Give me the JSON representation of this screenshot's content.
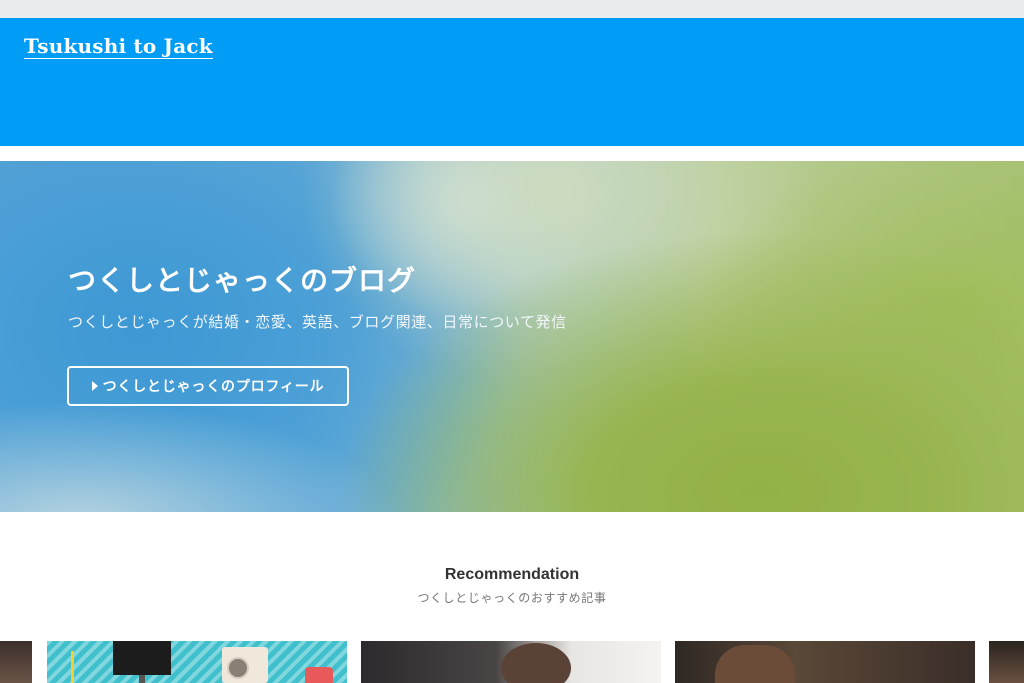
{
  "header": {
    "logo_text": "Tsukushi to Jack",
    "background_color": "#009cf5"
  },
  "hero": {
    "title": "つくしとじゃっくのブログ",
    "subtitle": "つくしとじゃっくが結婚・恋愛、英語、ブログ関連、日常について発信",
    "button_label": "つくしとじゃっくのプロフィール",
    "button_icon": "triangle-right-icon"
  },
  "recommendation": {
    "title": "Recommendation",
    "subtitle": "つくしとじゃっくのおすすめ記事"
  },
  "colors": {
    "accent": "#009cf5",
    "topbar": "#e9ebef"
  }
}
